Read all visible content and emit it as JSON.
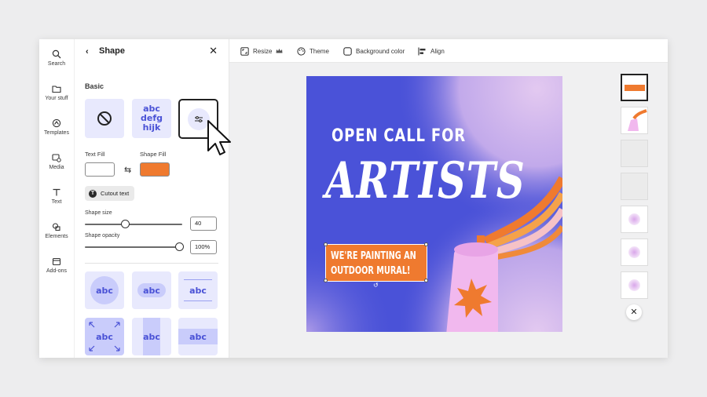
{
  "rail": {
    "items": [
      {
        "label": "Search",
        "icon": "search-icon"
      },
      {
        "label": "Your stuff",
        "icon": "folder-icon"
      },
      {
        "label": "Templates",
        "icon": "templates-icon"
      },
      {
        "label": "Media",
        "icon": "media-icon"
      },
      {
        "label": "Text",
        "icon": "text-icon"
      },
      {
        "label": "Elements",
        "icon": "elements-icon"
      },
      {
        "label": "Add-ons",
        "icon": "addons-icon"
      }
    ]
  },
  "panel": {
    "title": "Shape",
    "section_basic": "Basic",
    "text_fill_label": "Text Fill",
    "shape_fill_label": "Shape Fill",
    "text_fill_color": "#ffffff",
    "shape_fill_color": "#ef7a2f",
    "cutout_label": "Cutout text",
    "basic_tile_text": [
      "abc",
      "defg",
      "hijk"
    ],
    "shape_size_label": "Shape size",
    "shape_size_value": "40",
    "shape_size_level": 0.4,
    "shape_opacity_label": "Shape opacity",
    "shape_opacity_value": "100%",
    "shape_opacity_level": 1.0,
    "shape_tiles": [
      "abc",
      "abc",
      "abc",
      "abc",
      "abc",
      "abc"
    ]
  },
  "toolbar": {
    "resize_label": "Resize",
    "theme_label": "Theme",
    "background_label": "Background color",
    "align_label": "Align"
  },
  "artboard": {
    "line1": "OPEN CALL FOR",
    "line2": "ARTISTS",
    "mural_line1": "WE'RE PAINTING AN",
    "mural_line2": "OUTDOOR MURAL!",
    "background_color": "#4a52d8",
    "accent_color": "#ef7a2f",
    "can_color": "#f1b8ee"
  },
  "thumbnails": {
    "count": 7
  }
}
